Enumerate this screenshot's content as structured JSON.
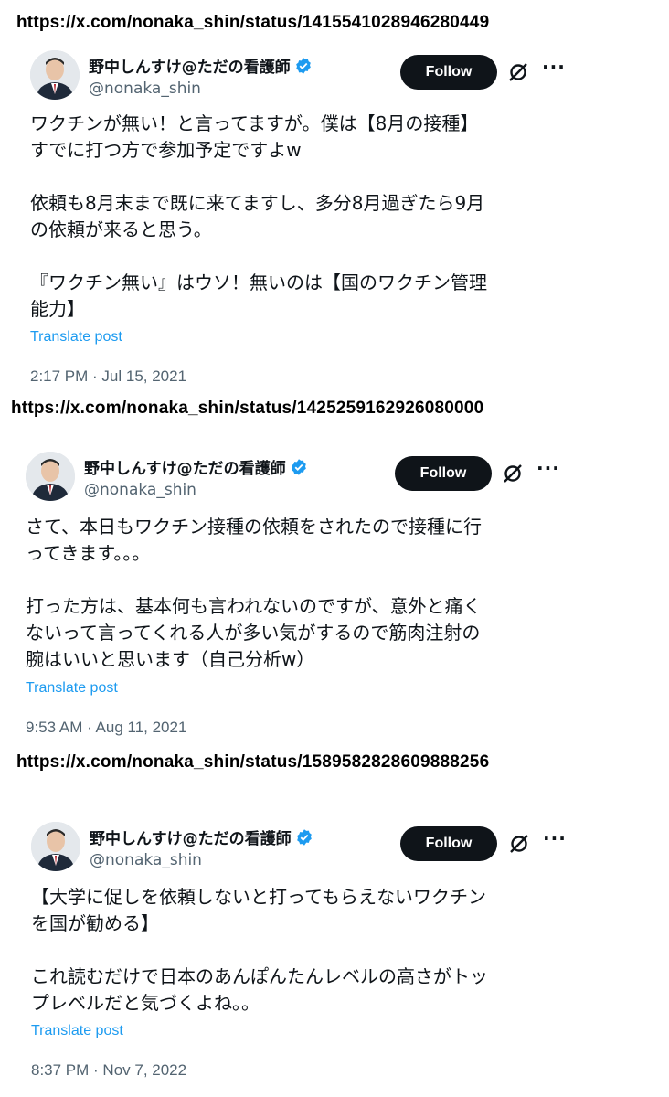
{
  "urls": [
    "https://x.com/nonaka_shin/status/1415541028946280449",
    "https://x.com/nonaka_shin/status/1425259162926080000",
    "https://x.com/nonaka_shin/status/1589582828609888256"
  ],
  "tweets": [
    {
      "display_name": "野中しんすけ@ただの看護師",
      "handle": "@nonaka_shin",
      "follow_label": "Follow",
      "more_label": "···",
      "body": "ワクチンが無い！と言ってますが。僕は【8月の接種】\nすでに打つ方で参加予定ですよw\n\n依頼も8月末まで既に来てますし、多分8月過ぎたら9月\nの依頼が来ると思う。\n\n『ワクチン無い』はウソ！無いのは【国のワクチン管理\n能力】",
      "translate": "Translate post",
      "timestamp": "2:17 PM · Jul 15, 2021"
    },
    {
      "display_name": "野中しんすけ@ただの看護師",
      "handle": "@nonaka_shin",
      "follow_label": "Follow",
      "more_label": "···",
      "body": "さて、本日もワクチン接種の依頼をされたので接種に行\nってきます。。。\n\n打った方は、基本何も言われないのですが、意外と痛く\nないって言ってくれる人が多い気がするので筋肉注射の\n腕はいいと思います（自己分析w）",
      "translate": "Translate post",
      "timestamp": "9:53 AM · Aug 11, 2021"
    },
    {
      "display_name": "野中しんすけ@ただの看護師",
      "handle": "@nonaka_shin",
      "follow_label": "Follow",
      "more_label": "···",
      "body": "【大学に促しを依頼しないと打ってもらえないワクチン\nを国が勧める】\n\nこれ読むだけで日本のあんぽんたんレベルの高さがトッ\nプレベルだと気づくよね。。",
      "translate": "Translate post",
      "timestamp": "8:37 PM · Nov 7, 2022"
    }
  ],
  "icons": {
    "verified": "verified-badge-icon",
    "grok": "grok-icon",
    "more": "more-icon"
  },
  "colors": {
    "follow_bg": "#0f1419",
    "link": "#1d9bf0",
    "verified": "#1d9bf0",
    "secondary_text": "#536471"
  }
}
